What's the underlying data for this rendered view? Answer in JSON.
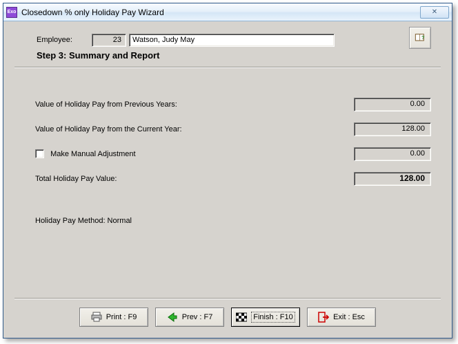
{
  "window": {
    "title": "Closedown % only Holiday Pay Wizard",
    "close_glyph": "✕"
  },
  "employee": {
    "label": "Employee:",
    "id": "23",
    "name": "Watson, Judy May"
  },
  "step": {
    "heading": "Step 3:   Summary and Report"
  },
  "rows": {
    "prev_years": {
      "label": "Value of Holiday Pay from Previous Years:",
      "value": "0.00"
    },
    "current_year": {
      "label": "Value of Holiday Pay from the Current Year:",
      "value": "128.00"
    },
    "manual_adj": {
      "label": "Make Manual Adjustment",
      "value": "0.00",
      "checked": false
    },
    "total": {
      "label": "Total Holiday Pay Value:",
      "value": "128.00"
    }
  },
  "method": {
    "text": "Holiday Pay Method:  Normal"
  },
  "buttons": {
    "print": "Print : F9",
    "prev": "Prev : F7",
    "finish": "Finish : F10",
    "exit": "Exit : Esc"
  }
}
